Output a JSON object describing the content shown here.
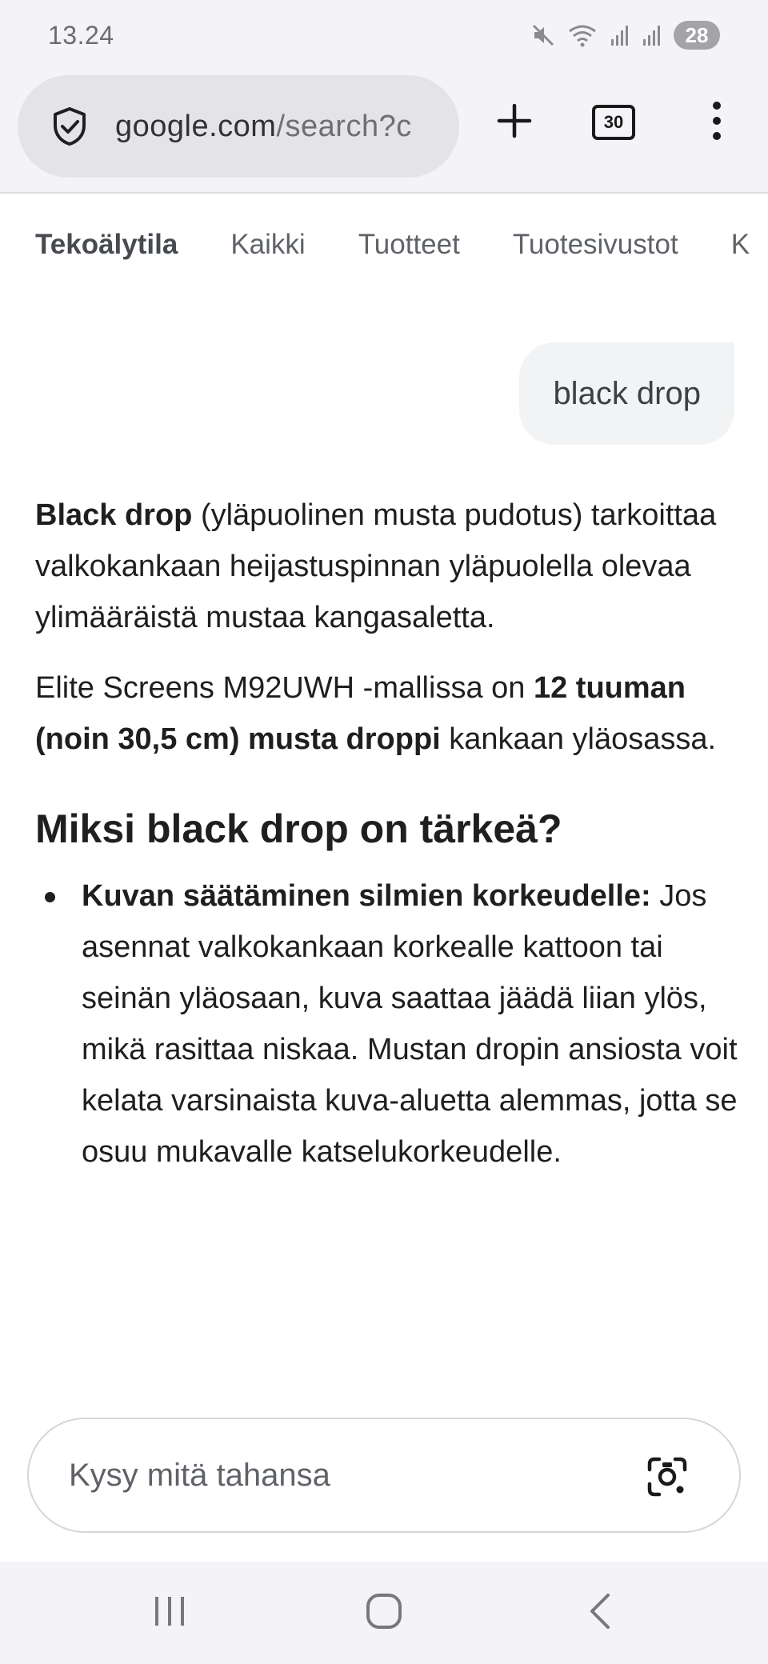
{
  "status_bar": {
    "time": "13.24",
    "battery": "28",
    "icons": [
      "mute-icon",
      "wifi-icon",
      "signal-icon",
      "signal-icon"
    ]
  },
  "browser": {
    "url_host": "google.com",
    "url_path": "/search?c",
    "tab_count": "30",
    "icons": [
      "shield-check-icon",
      "plus-icon",
      "tabs-icon",
      "more-vert-icon"
    ]
  },
  "search_tabs": [
    {
      "label": "Tekoälytila",
      "active": true
    },
    {
      "label": "Kaikki",
      "active": false
    },
    {
      "label": "Tuotteet",
      "active": false
    },
    {
      "label": "Tuotesivustot",
      "active": false
    },
    {
      "label": "K",
      "active": false
    }
  ],
  "query": "black drop",
  "answer": {
    "p1_bold": "Black drop",
    "p1_rest": " (yläpuolinen musta pudotus) tarkoittaa valkokankaan heijastuspinnan yläpuolella olevaa ylimääräistä mustaa kangasaletta.",
    "p2_start": "Elite Screens M92UWH -mallissa on ",
    "p2_bold": "12 tuuman (noin 30,5 cm) musta droppi",
    "p2_end": " kankaan yläosassa.",
    "heading": "Miksi black drop on tärkeä?",
    "bullets": [
      {
        "title": "Kuvan säätäminen silmien korkeudelle:",
        "text": " Jos asennat valkokankaan korkealle kattoon tai seinän yläosaan, kuva saattaa jäädä liian ylös, mikä rasittaa niskaa. Mustan dropin ansiosta voit kelata varsinaista kuva-aluetta alemmas, jotta se osuu mukavalle katselukorkeudelle."
      }
    ]
  },
  "ask": {
    "placeholder": "Kysy mitä tahansa",
    "icon": "google-lens-icon"
  },
  "nav": {
    "icons": [
      "recents-icon",
      "home-icon",
      "back-icon"
    ]
  }
}
